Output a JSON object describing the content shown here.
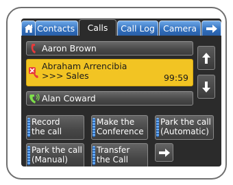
{
  "tabs": {
    "home_icon": "home-icon",
    "contacts": "Contacts",
    "calls": "Calls",
    "call_log": "Call Log",
    "camera": "Camera",
    "next_icon": "arrow-right-icon"
  },
  "calls": [
    {
      "name": "Aaron Brown",
      "icon": "phone-handset-icon",
      "state": "normal"
    },
    {
      "name": "Abraham Arrencibia",
      "subtitle": ">>> Sales",
      "timer": "99:59",
      "icon": "phone-mute-icon",
      "state": "active"
    },
    {
      "name": "Alan Coward",
      "icon": "phone-ringing-icon",
      "state": "normal"
    }
  ],
  "scroll": {
    "up_icon": "arrow-up-icon",
    "down_icon": "arrow-down-icon"
  },
  "actions": {
    "record": [
      "Record",
      "the call"
    ],
    "conference": [
      "Make the",
      "Conference"
    ],
    "park_auto": [
      "Park the call",
      "(Automatic)"
    ],
    "park_manual": [
      "Park the call",
      "(Manual)"
    ],
    "transfer": [
      "Transfer",
      "the Call"
    ],
    "next_icon": "arrow-right-icon"
  },
  "colors": {
    "tab_blue": "#2f6dbb",
    "active_call": "#f2c423",
    "screen_bg": "#2b2b2b"
  }
}
